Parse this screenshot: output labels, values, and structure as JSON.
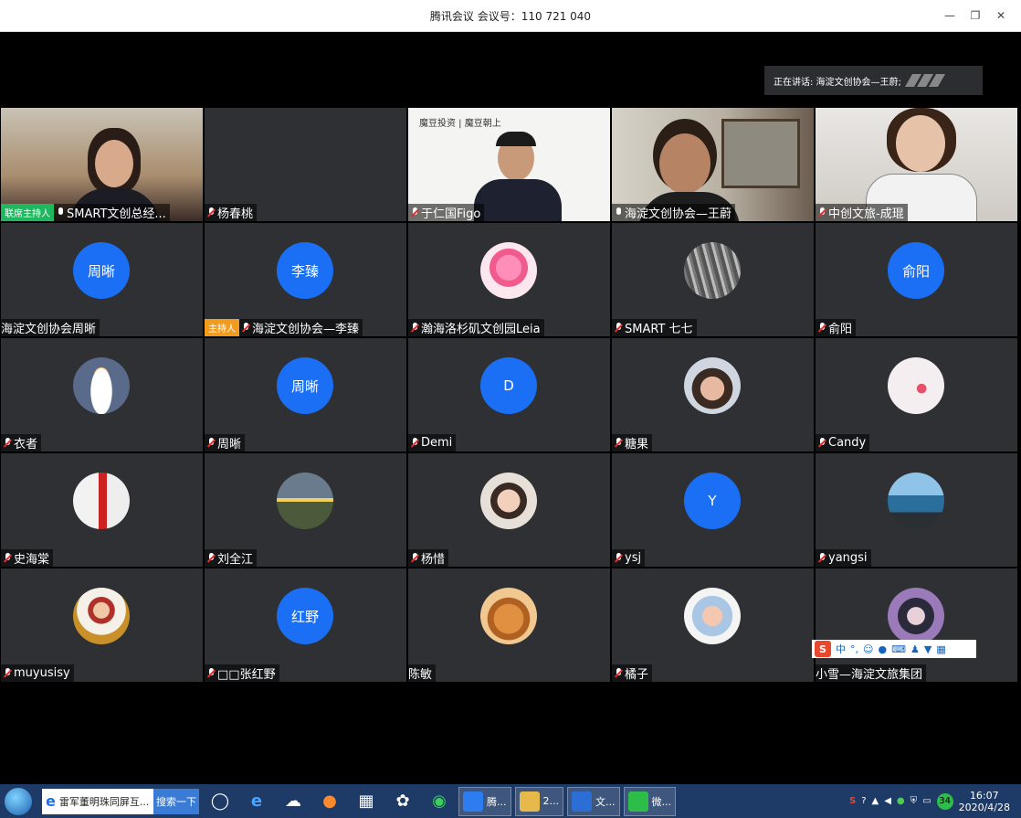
{
  "window": {
    "title": "腾讯会议 会议号：110 721 040"
  },
  "speaking": {
    "label": "正在讲话: 海淀文创协会—王蔚;"
  },
  "colors": {
    "avatar_blue": "#1b6ff5",
    "cohost_green": "#1fb85f",
    "host_orange": "#f29c1f",
    "tile_bg": "#2e3033"
  },
  "tiles": [
    {
      "name": "SMART文创总经...",
      "badge": "联席主持人",
      "mic": "on"
    },
    {
      "name": "杨春桃",
      "mic": "muted"
    },
    {
      "name": "于仁国Figo",
      "mic": "muted",
      "logo_text": "魔豆投资 | 魔豆朝上"
    },
    {
      "name": "海淀文创协会—王蔚",
      "mic": "on"
    },
    {
      "name": "中创文旅-成琨",
      "mic": "muted"
    },
    {
      "name": "海淀文创协会周晰",
      "avatar": "周晰"
    },
    {
      "name": "海淀文创协会—李臻",
      "badge": "主持人",
      "mic": "muted",
      "avatar": "李臻"
    },
    {
      "name": "瀚海洛杉矶文创园Leia",
      "mic": "muted"
    },
    {
      "name": "SMART  七七",
      "mic": "muted"
    },
    {
      "name": "俞阳",
      "mic": "muted",
      "avatar": "俞阳"
    },
    {
      "name": "衣者",
      "mic": "muted"
    },
    {
      "name": "周晰",
      "mic": "muted",
      "avatar": "周晰"
    },
    {
      "name": "Demi",
      "mic": "muted",
      "avatar": "D"
    },
    {
      "name": "糖果",
      "mic": "muted"
    },
    {
      "name": "Candy",
      "mic": "muted"
    },
    {
      "name": "史海棠",
      "mic": "muted"
    },
    {
      "name": "刘全江",
      "mic": "muted"
    },
    {
      "name": "杨惜",
      "mic": "muted"
    },
    {
      "name": "ysj",
      "mic": "muted",
      "avatar": "Y"
    },
    {
      "name": "yangsi",
      "mic": "muted"
    },
    {
      "name": "muyusisy",
      "mic": "muted"
    },
    {
      "name": "□□张红野",
      "mic": "muted",
      "avatar": "红野"
    },
    {
      "name": "陈敏"
    },
    {
      "name": "橘子",
      "mic": "muted"
    },
    {
      "name": "小雪—海淀文旅集团"
    }
  ],
  "ime": {
    "label": "中",
    "punct": "°,"
  },
  "taskbar": {
    "search_text": "雷军董明珠同屏互...",
    "search_button": "搜索一下",
    "apps": [
      {
        "label": "腾...",
        "color": "#2d7cf0"
      },
      {
        "label": "2...",
        "color": "#e7b94a"
      },
      {
        "label": "文...",
        "color": "#2b6fd6"
      },
      {
        "label": "微...",
        "color": "#2dbd49"
      }
    ],
    "tray_badge": "34",
    "clock_time": "16:07",
    "clock_date": "2020/4/28"
  }
}
